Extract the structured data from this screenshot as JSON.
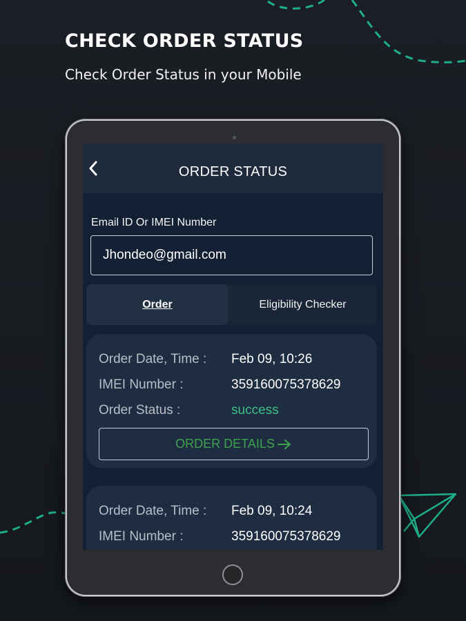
{
  "promo": {
    "headline": "CHECK ORDER STATUS",
    "subheadline": "Check Order Status in your Mobile"
  },
  "app_bar": {
    "title": "ORDER STATUS",
    "back_icon": "chevron-left-icon"
  },
  "search": {
    "label": "Email ID Or IMEI Number",
    "value": "Jhondeo@gmail.com"
  },
  "tabs": [
    {
      "label": "Order",
      "active": true
    },
    {
      "label": "Eligibility Checker",
      "active": false
    }
  ],
  "orders": [
    {
      "date_label": "Order Date, Time :",
      "date_value": "Feb 09, 10:26",
      "imei_label": "IMEI Number :",
      "imei_value": "359160075378629",
      "status_label": "Order Status :",
      "status_value": "success",
      "button_label": "ORDER DETAILS",
      "button_icon": "arrow-right-icon"
    },
    {
      "date_label": "Order Date, Time :",
      "date_value": "Feb 09, 10:24",
      "imei_label": "IMEI Number :",
      "imei_value": "359160075378629"
    }
  ],
  "colors": {
    "background": "#181b20",
    "screen": "#132034",
    "app_bar": "#1f2b3c",
    "card": "#1e2d41",
    "success": "#3fbf86",
    "details_button_text": "#3ea24e",
    "decoration": "#1fae8a"
  }
}
